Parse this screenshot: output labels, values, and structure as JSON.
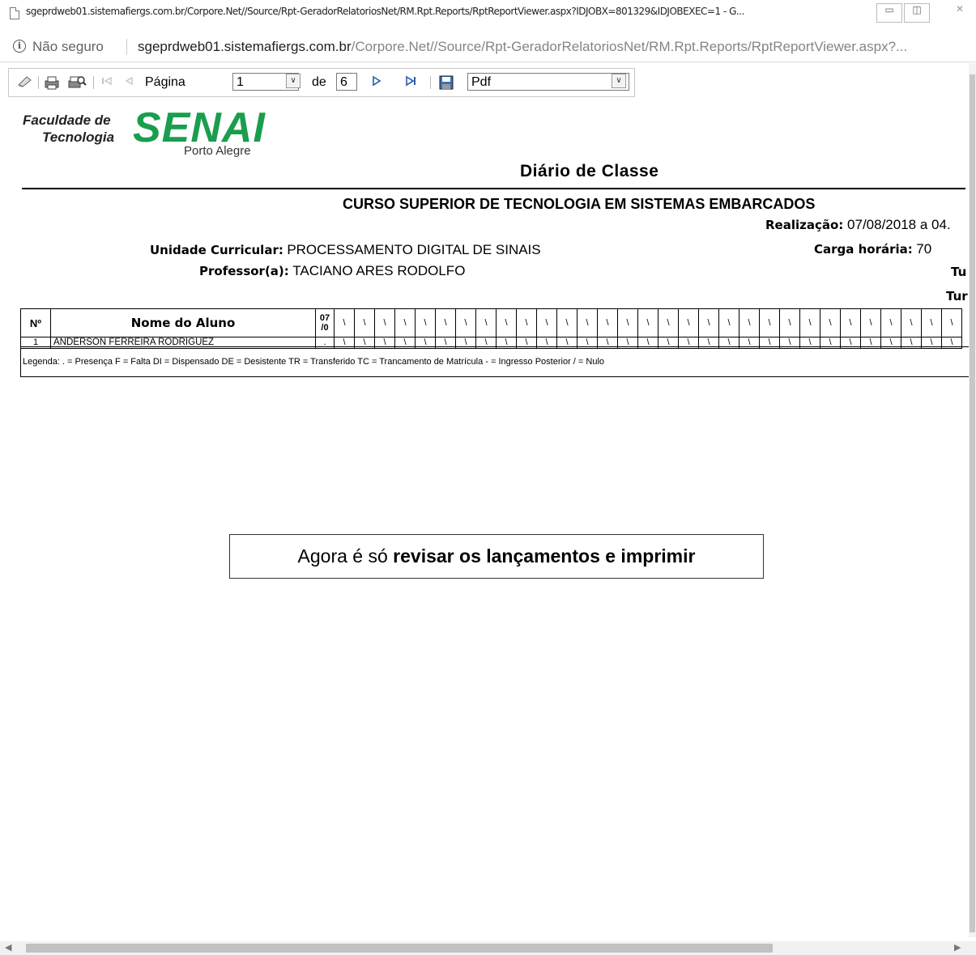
{
  "window": {
    "title": "sgeprdweb01.sistemafiergs.com.br/Corpore.Net//Source/Rpt-GeradorRelatoriosNet/RM.Rpt.Reports/RptReportViewer.aspx?IDJOBX=801329&IDJOBEXEC=1 - G...",
    "minimize": "▭",
    "maximize": "◫",
    "close": "✕"
  },
  "address_bar": {
    "security": "Não seguro",
    "url_host": "sgeprdweb01.sistemafiergs.com.br",
    "url_path": "/Corpore.Net//Source/Rpt-GeradorRelatoriosNet/RM.Rpt.Reports/RptReportViewer.aspx?..."
  },
  "toolbar": {
    "page_label": "Página",
    "page_value": "1",
    "of_label": "de",
    "total_pages": "6",
    "export_format": "Pdf",
    "icons": [
      "refresh-icon",
      "print-icon",
      "print-preview-icon",
      "first-page-icon",
      "prev-page-icon",
      "next-page-icon",
      "last-page-icon",
      "save-icon"
    ]
  },
  "report": {
    "logo_line1": "Faculdade de",
    "logo_line2": "Tecnologia",
    "logo_brand": "SENAI",
    "logo_city": "Porto Alegre",
    "title": "Diário de Classe",
    "course": "CURSO SUPERIOR DE TECNOLOGIA EM SISTEMAS EMBARCADOS",
    "realizacao_label": "Realização:",
    "realizacao_value": "07/08/2018 a 04.",
    "unidade_label": "Unidade Curricular:",
    "unidade_value": "PROCESSAMENTO DIGITAL DE SINAIS",
    "carga_label": "Carga horária:",
    "carga_value": "70",
    "professor_label": "Professor(a):",
    "professor_value": "TACIANO ARES RODOLFO",
    "turma1": "Tu",
    "turma2": "Tur",
    "table": {
      "col_n": "Nº",
      "col_name": "Nome do Aluno",
      "col_date": "07 /0",
      "cell_mark": "\\",
      "rows": [
        {
          "n": "1",
          "name": "ÂNDERSON FERREIRA RODRIGUEZ",
          "first": "."
        }
      ]
    },
    "legend": "Legenda: . = Presença F = Falta DI = Dispensado DE = Desistente TR = Transferido TC = Trancamento de Matrícula - = Ingresso Posterior / = Nulo"
  },
  "callout": {
    "plain": "Agora é só ",
    "bold": "revisar os lançamentos e imprimir"
  },
  "colors": {
    "brand_green": "#1a9e4e"
  }
}
